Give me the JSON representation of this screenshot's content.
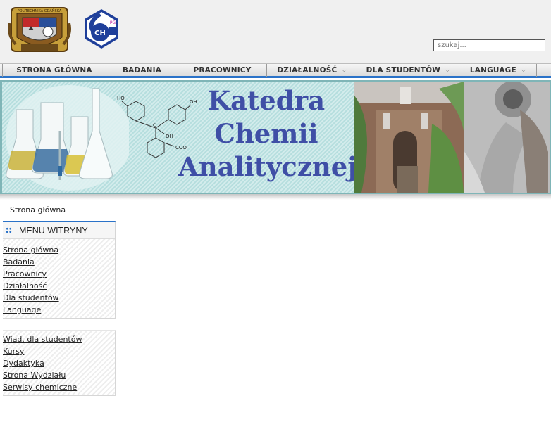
{
  "header": {
    "search": {
      "placeholder": "szukaj..."
    },
    "logos": {
      "university_crest_text": "POLITECHNIKA GDAŃSKA",
      "faculty_logo_text": "CH",
      "faculty_logo_mark": "PG"
    }
  },
  "nav": {
    "items": [
      {
        "label": "STRONA GŁÓWNA",
        "dropdown": false
      },
      {
        "label": "BADANIA",
        "dropdown": false
      },
      {
        "label": "PRACOWNICY",
        "dropdown": false
      },
      {
        "label": "DZIAŁALNOŚĆ",
        "dropdown": true
      },
      {
        "label": "DLA STUDENTÓW",
        "dropdown": true
      },
      {
        "label": "LANGUAGE",
        "dropdown": true
      }
    ],
    "accent": "#2a72c8"
  },
  "banner": {
    "title_line1": "Katedra",
    "title_line2": "Chemii",
    "title_line3": "Analitycznej",
    "title_color": "#3f4fa6",
    "molecule_labels": {
      "ho1": "HO",
      "oh1": "OH",
      "oh2": "OH",
      "c": "C",
      "coo": "COO"
    }
  },
  "breadcrumb": "Strona główna",
  "menu": {
    "title": "MENU WITRYNY",
    "links": [
      "Strona główna",
      "Badania",
      "Pracownicy",
      "Działalność",
      "Dla studentów",
      "Language"
    ]
  },
  "secondary": {
    "links": [
      "Wiad. dla studentów",
      "Kursy",
      "Dydaktyka",
      "Strona Wydziału",
      "Serwisy chemiczne"
    ]
  }
}
